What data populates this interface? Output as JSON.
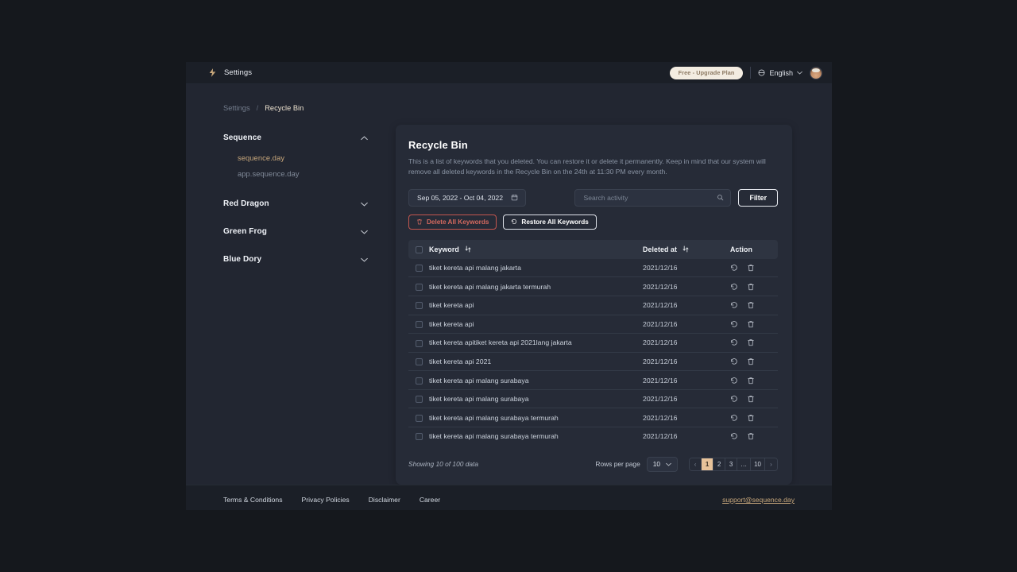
{
  "topbar": {
    "logo_icon": "lightning-bolt-logo",
    "title": "Settings",
    "plan_badge": "Free - Upgrade Plan",
    "language": "English",
    "globe_icon": "globe-icon",
    "caret_icon": "chevron-down-icon",
    "avatar_icon": "user-avatar"
  },
  "breadcrumb": {
    "parent": "Settings",
    "separator": "/",
    "current": "Recycle Bin"
  },
  "sidebar": {
    "groups": [
      {
        "label": "Sequence",
        "expanded": true,
        "chevron": "chevron-up-icon",
        "items": [
          {
            "label": "sequence.day",
            "active": true
          },
          {
            "label": "app.sequence.day",
            "active": false
          }
        ]
      },
      {
        "label": "Red Dragon",
        "expanded": false,
        "chevron": "chevron-down-icon",
        "items": []
      },
      {
        "label": "Green Frog",
        "expanded": false,
        "chevron": "chevron-down-icon",
        "items": []
      },
      {
        "label": "Blue Dory",
        "expanded": false,
        "chevron": "chevron-down-icon",
        "items": []
      }
    ]
  },
  "card": {
    "title": "Recycle Bin",
    "description": "This is a list of keywords that you deleted. You can restore it or delete it permanently. Keep in mind that our system will remove all deleted keywords in the Recycle Bin on the 24th at 11:30 PM every month.",
    "date_range": "Sep 05, 2022 - Oct 04, 2022",
    "calendar_icon": "calendar-icon",
    "search_placeholder": "Search activity",
    "search_value": "",
    "search_icon": "search-icon",
    "filter_label": "Filter",
    "delete_all_label": "Delete All Keywords",
    "delete_all_icon": "trash-icon",
    "restore_all_label": "Restore All Keywords",
    "restore_all_icon": "restore-icon"
  },
  "table": {
    "columns": {
      "keyword": "Keyword",
      "deleted_at": "Deleted at",
      "action": "Action"
    },
    "sort_icon": "sort-icon",
    "restore_icon": "restore-icon",
    "delete_icon": "trash-icon",
    "rows": [
      {
        "keyword": "tiket kereta api malang jakarta",
        "deleted_at": "2021/12/16"
      },
      {
        "keyword": "tiket kereta api malang jakarta termurah",
        "deleted_at": "2021/12/16"
      },
      {
        "keyword": "tiket kereta api",
        "deleted_at": "2021/12/16"
      },
      {
        "keyword": "tiket kereta api",
        "deleted_at": "2021/12/16"
      },
      {
        "keyword": "tiket kereta apitiket kereta api 2021lang jakarta",
        "deleted_at": "2021/12/16"
      },
      {
        "keyword": "tiket kereta api 2021",
        "deleted_at": "2021/12/16"
      },
      {
        "keyword": "tiket kereta api malang surabaya",
        "deleted_at": "2021/12/16"
      },
      {
        "keyword": "tiket kereta api malang surabaya",
        "deleted_at": "2021/12/16"
      },
      {
        "keyword": "tiket kereta api malang surabaya termurah",
        "deleted_at": "2021/12/16"
      },
      {
        "keyword": "tiket kereta api malang surabaya termurah",
        "deleted_at": "2021/12/16"
      }
    ]
  },
  "pagination": {
    "showing": "Showing 10 of 100 data",
    "rows_per_page_label": "Rows per page",
    "rows_per_page_value": "10",
    "prev": "‹",
    "next": "›",
    "pages": [
      "1",
      "2",
      "3",
      "…",
      "10"
    ],
    "active_page": "1"
  },
  "footer": {
    "links": [
      "Terms & Conditions",
      "Privacy Policies",
      "Disclaimer",
      "Career"
    ],
    "email": "support@sequence.day"
  },
  "colors": {
    "accent": "#c9a87c",
    "page_bg": "#222631",
    "card_bg": "#262b37",
    "danger": "#d4695f",
    "badge_bg": "#f3ece1",
    "active_page_bg": "#e8c39a"
  }
}
